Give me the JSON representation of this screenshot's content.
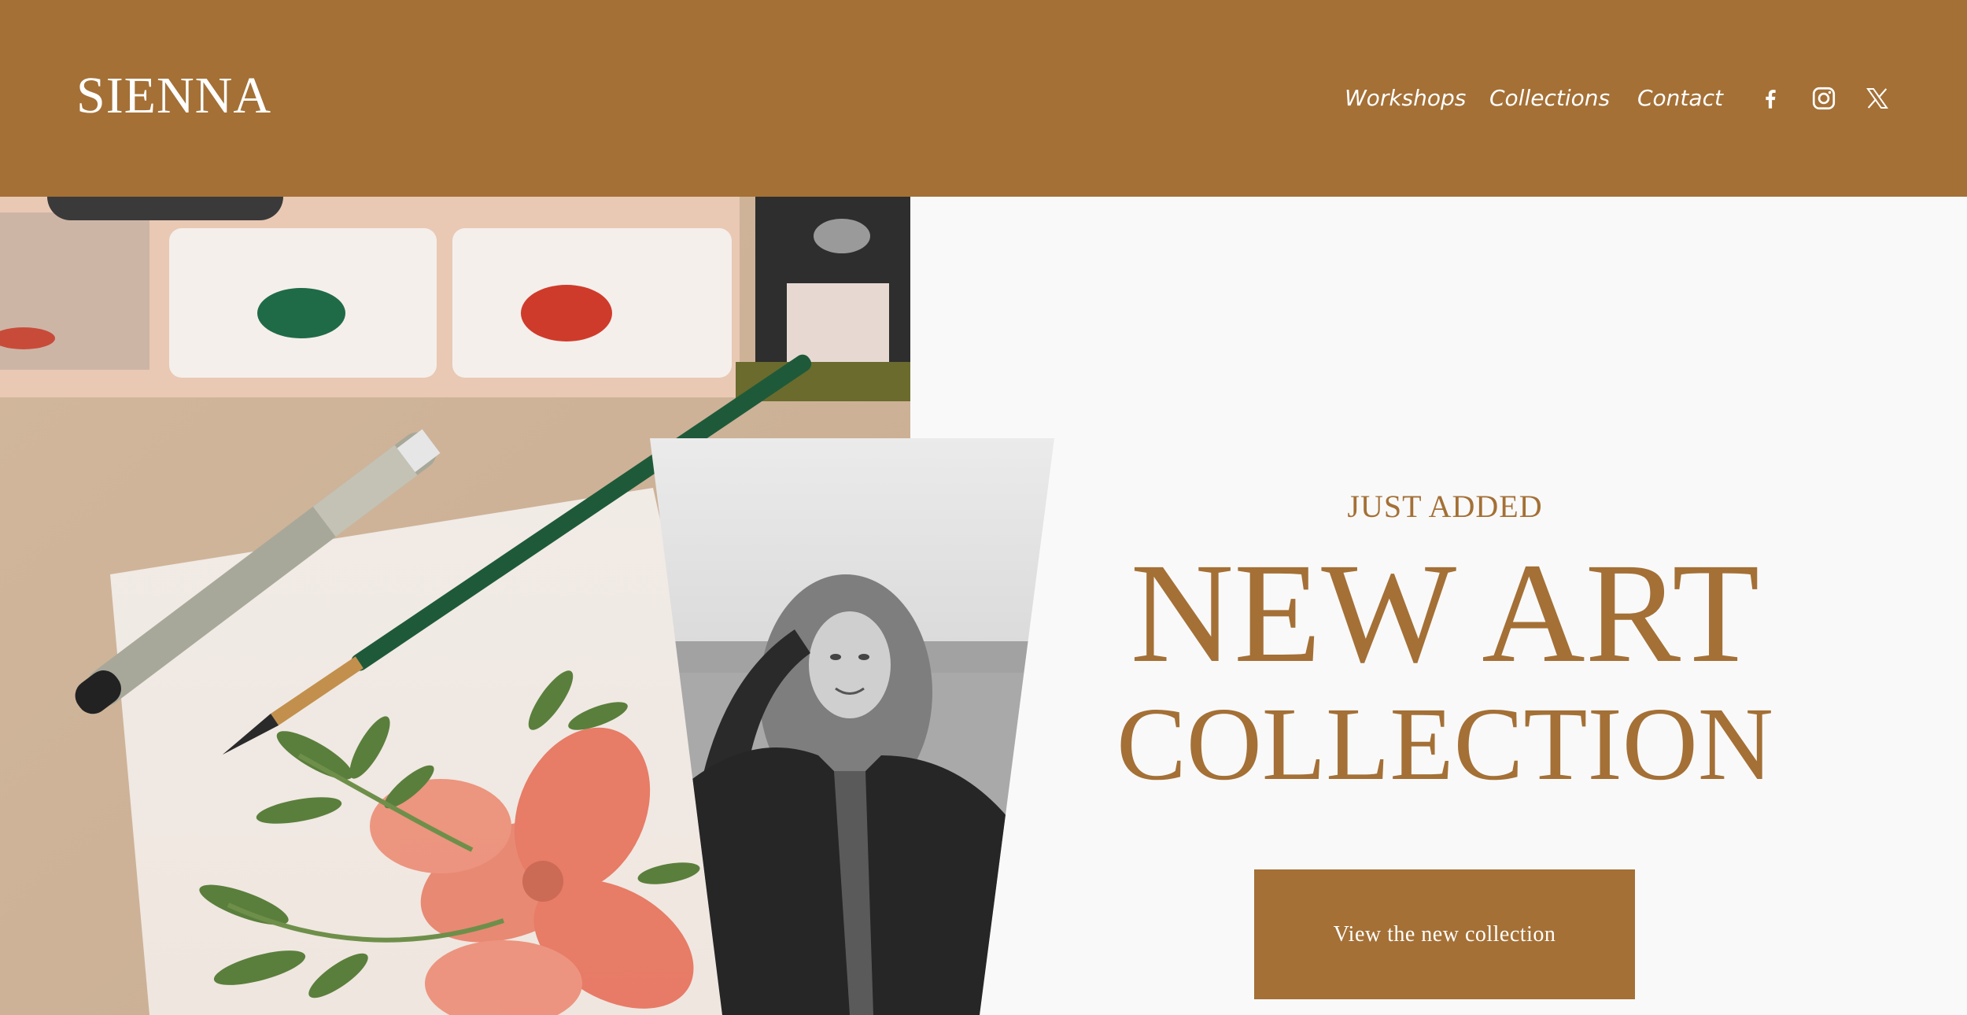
{
  "brand": {
    "logo_text": "SIENNA",
    "color": "#a47036"
  },
  "nav": {
    "items": [
      {
        "label": "Workshops"
      },
      {
        "label": "Collections"
      },
      {
        "label": "Contact"
      }
    ]
  },
  "social": [
    {
      "icon": "facebook-icon"
    },
    {
      "icon": "instagram-icon"
    },
    {
      "icon": "x-twitter-icon"
    }
  ],
  "hero": {
    "eyebrow": "JUST ADDED",
    "headline_line1": "NEW ART",
    "headline_line2": "COLLECTION",
    "cta_label": "View the new collection",
    "background": "#f9f9f9"
  },
  "images": {
    "main": "watercolor-painting-desk-photo",
    "secondary": "black-and-white-portrait-photo"
  }
}
